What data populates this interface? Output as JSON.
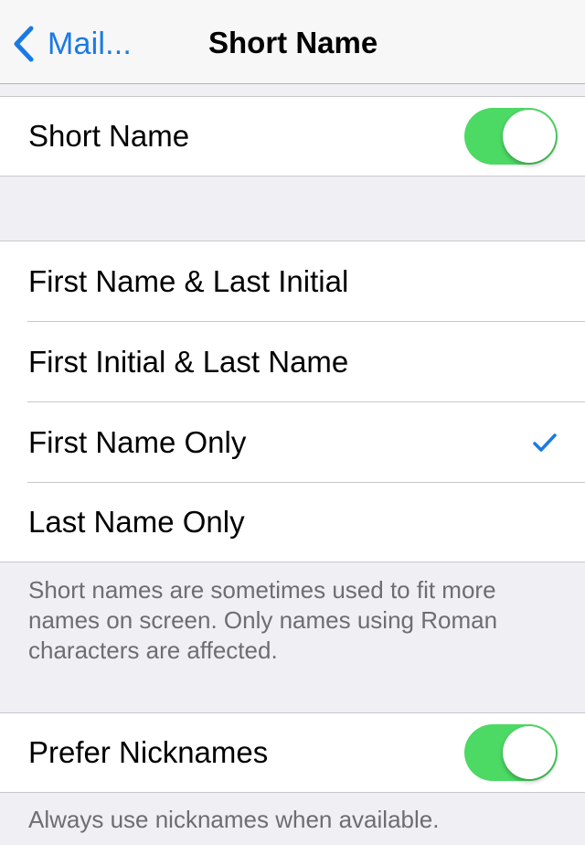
{
  "nav": {
    "back_label": "Mail...",
    "title": "Short Name"
  },
  "short_name_section": {
    "label": "Short Name",
    "toggle_on": true
  },
  "format_options": [
    {
      "label": "First Name & Last Initial",
      "selected": false
    },
    {
      "label": "First Initial & Last Name",
      "selected": false
    },
    {
      "label": "First Name Only",
      "selected": true
    },
    {
      "label": "Last Name Only",
      "selected": false
    }
  ],
  "format_footer": "Short names are sometimes used to fit more names on screen. Only names using Roman characters are affected.",
  "nicknames_section": {
    "label": "Prefer Nicknames",
    "toggle_on": true,
    "footer": "Always use nicknames when available."
  },
  "colors": {
    "accent": "#1a7ae3",
    "toggle_on": "#4cd964",
    "background": "#efeff4",
    "footer_text": "#6d6d72"
  }
}
